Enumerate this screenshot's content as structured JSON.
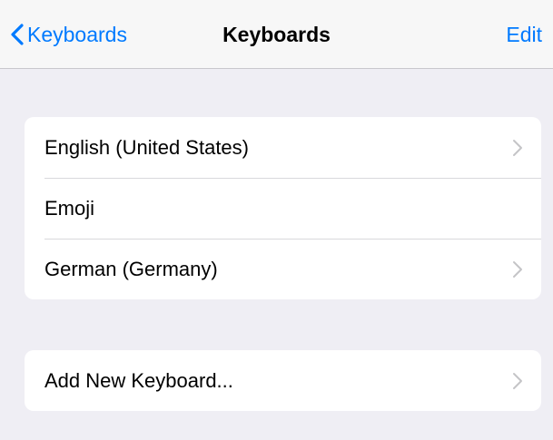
{
  "navbar": {
    "back_label": "Keyboards",
    "title": "Keyboards",
    "edit_label": "Edit"
  },
  "keyboards": [
    {
      "label": "English (United States)",
      "has_chevron": true
    },
    {
      "label": "Emoji",
      "has_chevron": false
    },
    {
      "label": "German (Germany)",
      "has_chevron": true
    }
  ],
  "add_keyboard": {
    "label": "Add New Keyboard...",
    "has_chevron": true
  },
  "colors": {
    "accent": "#007aff",
    "background": "#efeef4",
    "cell": "#ffffff",
    "separator": "#d8d8dc",
    "chevron": "#c4c4c7"
  },
  "icons": {
    "back": "chevron-left-icon",
    "disclosure": "chevron-right-icon"
  }
}
